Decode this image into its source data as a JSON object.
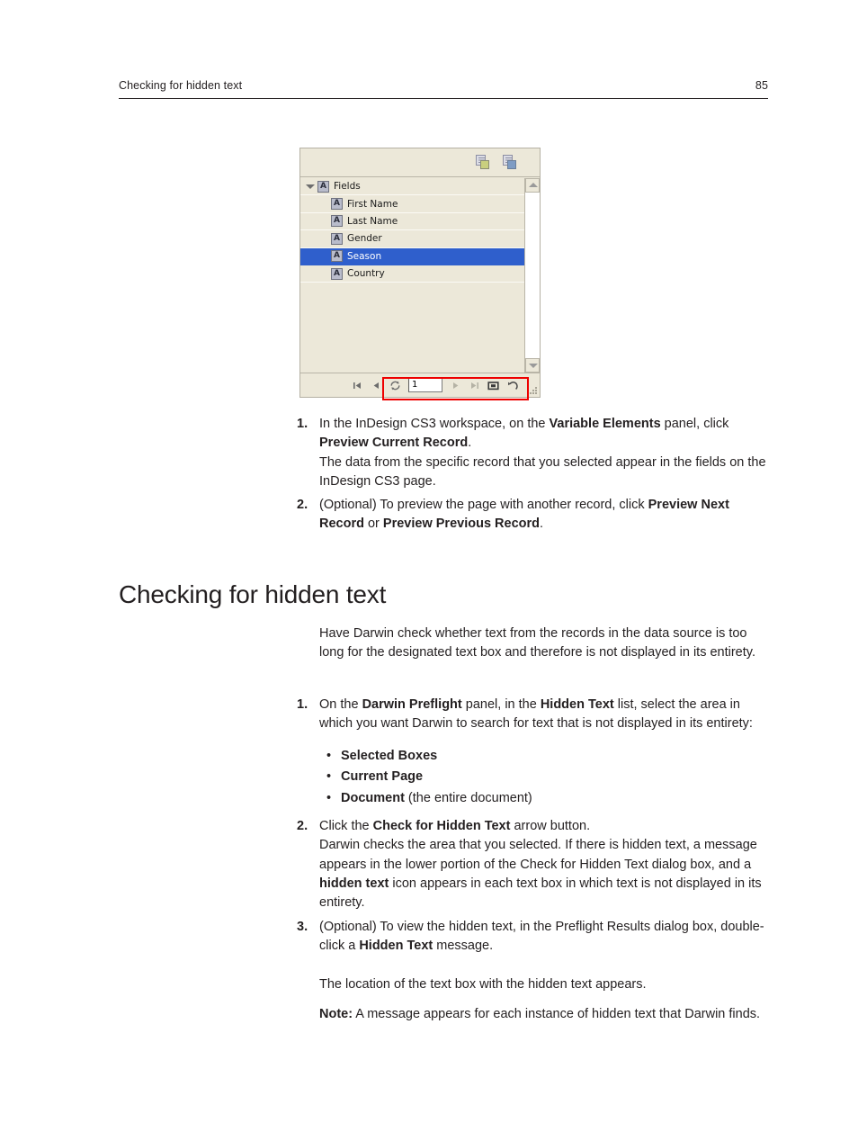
{
  "header": {
    "title": "Checking for hidden text",
    "page_number": "85"
  },
  "screenshot": {
    "name": "variable-elements-panel",
    "toolbar": {
      "icons": [
        {
          "name": "create-variable-text-icon",
          "accent": "#c9cf7e"
        },
        {
          "name": "create-variable-image-icon",
          "accent": "#7e9cc4"
        }
      ]
    },
    "tree": {
      "root_label": "Fields",
      "items": [
        {
          "label": "First Name",
          "selected": false
        },
        {
          "label": "Last Name",
          "selected": false
        },
        {
          "label": "Gender",
          "selected": false
        },
        {
          "label": "Season",
          "selected": true
        },
        {
          "label": "Country",
          "selected": false
        }
      ],
      "selection_color": "#2f5fcc",
      "field_type_icon": "A"
    },
    "navbar": {
      "record_value": "1",
      "buttons": [
        {
          "name": "preview-first-record-button",
          "glyph": "first"
        },
        {
          "name": "preview-previous-record-button",
          "glyph": "previous"
        },
        {
          "name": "preview-current-record-button",
          "glyph": "refresh"
        },
        {
          "name": "preview-next-record-button",
          "glyph": "next"
        },
        {
          "name": "preview-last-record-button",
          "glyph": "last"
        },
        {
          "name": "preview-mode-button",
          "glyph": "preview"
        },
        {
          "name": "revert-button",
          "glyph": "revert"
        }
      ]
    },
    "annotation": {
      "color": "#ee0000",
      "target": "record-navigation-controls"
    }
  },
  "steps_top": [
    {
      "number": "1.",
      "parts": [
        {
          "t": "In the InDesign CS3 workspace, on the ",
          "b": false
        },
        {
          "t": "Variable Elements",
          "b": true
        },
        {
          "t": " panel, click ",
          "b": false
        },
        {
          "t": "Preview Current Record",
          "b": true
        },
        {
          "t": ".",
          "b": false
        },
        {
          "t": "\nThe data from the specific record that you selected appear in the fields on the InDesign CS3 page.",
          "b": false
        }
      ]
    },
    {
      "number": "2.",
      "parts": [
        {
          "t": "(Optional) To preview the page with another record, click ",
          "b": false
        },
        {
          "t": "Preview Next Record",
          "b": true
        },
        {
          "t": " or ",
          "b": false
        },
        {
          "t": "Preview Previous Record",
          "b": true
        },
        {
          "t": ".",
          "b": false
        }
      ]
    }
  ],
  "section": {
    "title": "Checking for hidden text",
    "intro": "Have Darwin check whether text from the records in the data source is too long for the designated text box and therefore is not displayed in its entirety."
  },
  "steps_main": [
    {
      "number": "1.",
      "parts": [
        {
          "t": "On the ",
          "b": false
        },
        {
          "t": "Darwin Preflight",
          "b": true
        },
        {
          "t": " panel, in the ",
          "b": false
        },
        {
          "t": "Hidden Text",
          "b": true
        },
        {
          "t": " list, select the area in which you want Darwin to search for text that is not displayed in its entirety:",
          "b": false
        }
      ],
      "bullets": [
        {
          "bold": "Selected Boxes",
          "rest": ""
        },
        {
          "bold": "Current Page",
          "rest": ""
        },
        {
          "bold": "Document",
          "rest": " (the entire document)"
        }
      ]
    },
    {
      "number": "2.",
      "parts": [
        {
          "t": "Click the ",
          "b": false
        },
        {
          "t": "Check for Hidden Text",
          "b": true
        },
        {
          "t": " arrow button.",
          "b": false
        },
        {
          "t": "\nDarwin checks the area that you selected. If there is hidden text, a message appears in the lower portion of the Check for Hidden Text dialog box, and a ",
          "b": false
        },
        {
          "t": "hidden text",
          "b": true
        },
        {
          "t": " icon appears in each text box in which text is not displayed in its entirety.",
          "b": false
        }
      ]
    },
    {
      "number": "3.",
      "parts": [
        {
          "t": "(Optional) To view the hidden text, in the Preflight Results dialog box, double-click a ",
          "b": false
        },
        {
          "t": "Hidden Text",
          "b": true
        },
        {
          "t": " message.",
          "b": false
        }
      ]
    }
  ],
  "closing": {
    "result": "The location of the text box with the hidden text appears.",
    "note_label": "Note:",
    "note_text": " A message appears for each instance of hidden text that Darwin finds."
  }
}
